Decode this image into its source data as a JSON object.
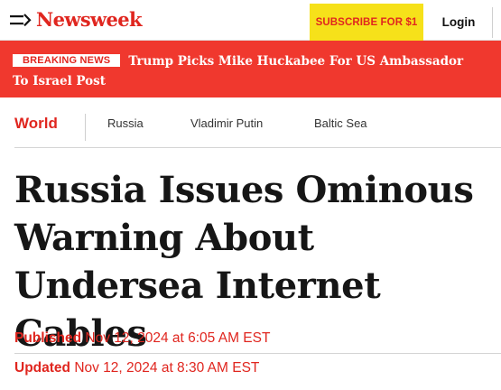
{
  "header": {
    "logo": "Newsweek",
    "subscribe_label": "SUBSCRIBE FOR $1",
    "login_label": "Login"
  },
  "breaking": {
    "badge": "BREAKING NEWS",
    "text": "Trump Picks Mike Huckabee For US Ambassador To Israel Post"
  },
  "topics": {
    "primary": "World",
    "items": [
      "Russia",
      "Vladimir Putin",
      "Baltic Sea"
    ]
  },
  "article": {
    "headline": "Russia Issues Ominous Warning About Undersea Internet Cables",
    "published_label": "Published",
    "published_date": "Nov 12, 2024 at 6:05 AM EST",
    "updated_label": "Updated",
    "updated_date": "Nov 12, 2024 at 8:30 AM EST"
  },
  "colors": {
    "brand_red": "#e0261f",
    "breaking_bg": "#f0382e",
    "subscribe_bg": "#f6e11a"
  },
  "icons": {
    "menu": "menu-icon"
  }
}
